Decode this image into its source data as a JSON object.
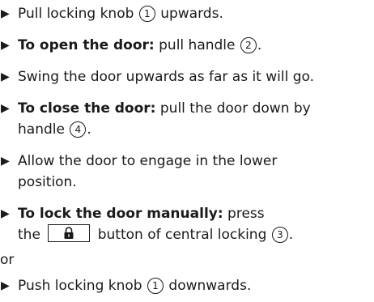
{
  "steps": [
    {
      "bold": "",
      "pre": "Pull locking knob ",
      "ref": "1",
      "post": " upwards."
    },
    {
      "bold": "To open the door:",
      "pre": " pull handle ",
      "ref": "2",
      "post": "."
    },
    {
      "text": "Swing the door upwards as far as it will go."
    },
    {
      "bold": "To close the door:",
      "line1": " pull the door down by",
      "line2_pre": "handle ",
      "ref": "4",
      "line2_post": "."
    },
    {
      "line1": "Allow the door to engage in the lower",
      "line2": "position."
    },
    {
      "bold": "To lock the door manually:",
      "line1": " press",
      "line2_pre": "the ",
      "button_icon": "padlock-icon",
      "line2_mid": " button of central locking ",
      "ref": "3",
      "line2_post": "."
    },
    {
      "bold": "",
      "pre": "Push locking knob ",
      "ref": "1",
      "post": " downwards."
    }
  ],
  "or_text": "or",
  "bullet_glyph": "▶"
}
